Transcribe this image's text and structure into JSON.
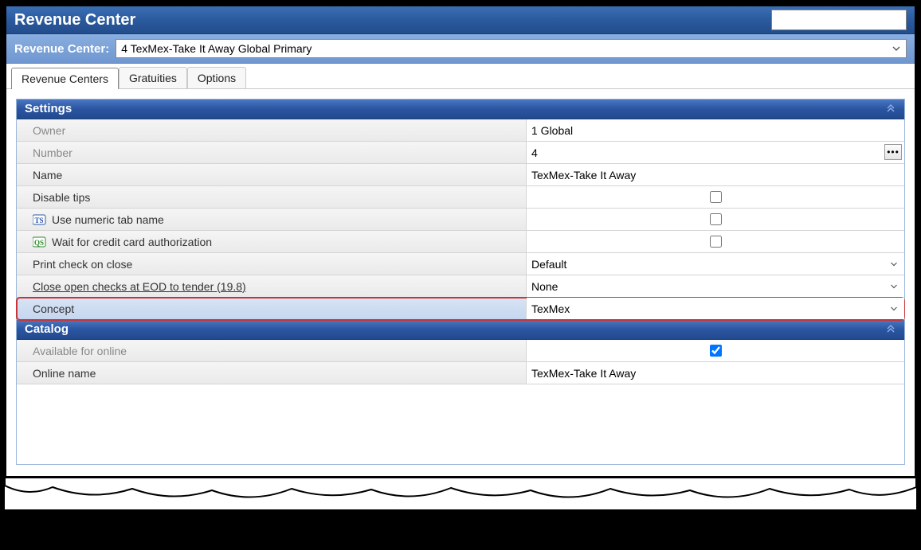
{
  "header": {
    "title": "Revenue Center"
  },
  "selector": {
    "label": "Revenue Center:",
    "value": "4 TexMex-Take It Away Global Primary"
  },
  "tabs": [
    {
      "label": "Revenue Centers",
      "active": true
    },
    {
      "label": "Gratuities",
      "active": false
    },
    {
      "label": "Options",
      "active": false
    }
  ],
  "sections": {
    "settings": {
      "title": "Settings",
      "rows": {
        "owner": {
          "label": "Owner",
          "value": "1  Global"
        },
        "number": {
          "label": "Number",
          "value": "4"
        },
        "name": {
          "label": "Name",
          "value": "TexMex-Take It Away"
        },
        "disable_tips": {
          "label": "Disable tips",
          "checked": false
        },
        "numeric_tab": {
          "label": "Use numeric tab name",
          "checked": false
        },
        "wait_cc": {
          "label": "Wait for credit card authorization",
          "checked": false
        },
        "print_check": {
          "label": "Print check on close",
          "value": "Default"
        },
        "close_eod": {
          "label": "Close open checks at EOD to tender (19.8)",
          "value": "None"
        },
        "concept": {
          "label": "Concept",
          "value": "TexMex"
        }
      }
    },
    "catalog": {
      "title": "Catalog",
      "rows": {
        "avail_online": {
          "label": "Available for online",
          "checked": true
        },
        "online_name": {
          "label": "Online name",
          "value": "TexMex-Take It Away"
        }
      }
    }
  }
}
